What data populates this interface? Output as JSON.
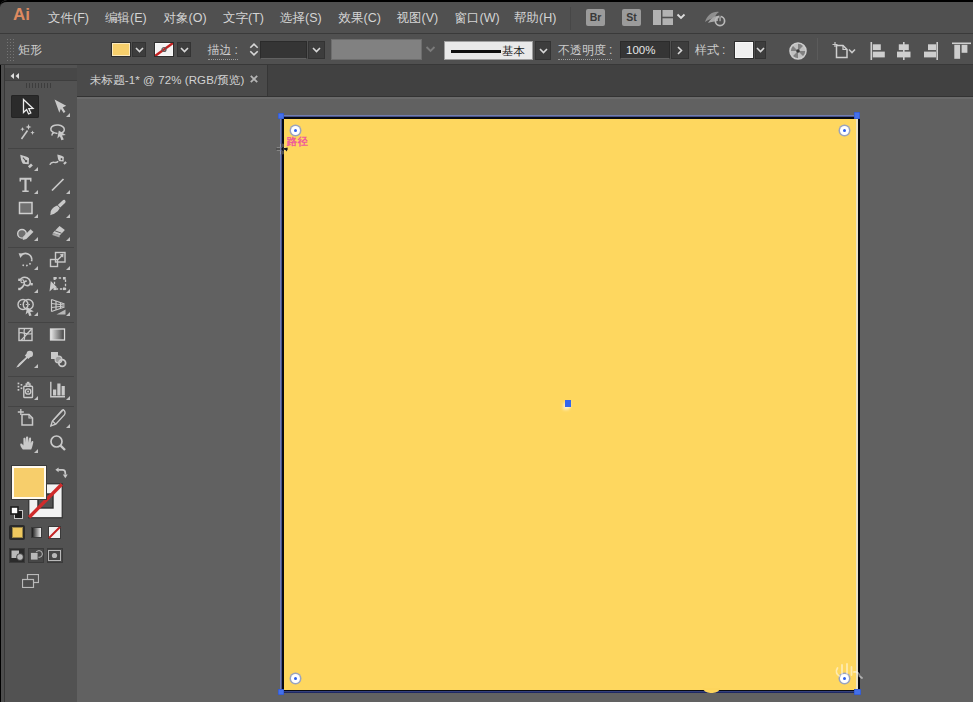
{
  "app": {
    "logo": "Ai",
    "accent_colors": {
      "fill_yellow": "#fcd464",
      "selection_blue": "#3d6bef",
      "smart_guide_pink": "#e95fa8"
    }
  },
  "menu_bar": {
    "items": [
      {
        "label": "文件(F)"
      },
      {
        "label": "编辑(E)"
      },
      {
        "label": "对象(O)"
      },
      {
        "label": "文字(T)"
      },
      {
        "label": "选择(S)"
      },
      {
        "label": "效果(C)"
      },
      {
        "label": "视图(V)"
      },
      {
        "label": "窗口(W)"
      },
      {
        "label": "帮助(H)"
      }
    ],
    "bridge_button": "Br",
    "stock_button": "St"
  },
  "control_bar": {
    "selection_type_label": "矩形",
    "stroke_label": "描边",
    "stroke_colon": ":",
    "stroke_width_value": "",
    "brush_name": "基本",
    "opacity_label": "不透明度",
    "opacity_colon": ":",
    "opacity_value": "100%",
    "style_label": "样式",
    "style_colon": ":"
  },
  "document_tab": {
    "title": "未标题-1* @ 72% (RGB/预览)"
  },
  "tools": [
    {
      "id": "selection-tool",
      "icon": "selection",
      "selected": true,
      "col": 0,
      "row": 0,
      "fly": false
    },
    {
      "id": "direct-selection-tool",
      "icon": "direct",
      "selected": false,
      "col": 1,
      "row": 0,
      "fly": true
    },
    {
      "id": "magic-wand-tool",
      "icon": "wand",
      "selected": false,
      "col": 0,
      "row": 1,
      "fly": false
    },
    {
      "id": "lasso-tool",
      "icon": "lasso",
      "selected": false,
      "col": 1,
      "row": 1,
      "fly": false
    },
    {
      "id": "pen-tool",
      "icon": "pen",
      "selected": false,
      "col": 0,
      "row": 2,
      "fly": true
    },
    {
      "id": "curvature-tool",
      "icon": "curvature",
      "selected": false,
      "col": 1,
      "row": 2,
      "fly": false
    },
    {
      "id": "type-tool",
      "icon": "type",
      "selected": false,
      "col": 0,
      "row": 3,
      "fly": true
    },
    {
      "id": "line-segment-tool",
      "icon": "line",
      "selected": false,
      "col": 1,
      "row": 3,
      "fly": true
    },
    {
      "id": "rectangle-tool",
      "icon": "rect",
      "selected": false,
      "col": 0,
      "row": 4,
      "fly": true
    },
    {
      "id": "paintbrush-tool",
      "icon": "brush",
      "selected": false,
      "col": 1,
      "row": 4,
      "fly": true
    },
    {
      "id": "shaper-tool",
      "icon": "shaper",
      "selected": false,
      "col": 0,
      "row": 5,
      "fly": true
    },
    {
      "id": "eraser-tool",
      "icon": "eraser",
      "selected": false,
      "col": 1,
      "row": 5,
      "fly": true
    },
    {
      "id": "rotate-tool",
      "icon": "rotate",
      "selected": false,
      "col": 0,
      "row": 6,
      "fly": true
    },
    {
      "id": "scale-tool",
      "icon": "scale",
      "selected": false,
      "col": 1,
      "row": 6,
      "fly": true
    },
    {
      "id": "width-tool",
      "icon": "width",
      "selected": false,
      "col": 0,
      "row": 7,
      "fly": true
    },
    {
      "id": "free-transform-tool",
      "icon": "freet",
      "selected": false,
      "col": 1,
      "row": 7,
      "fly": true
    },
    {
      "id": "shape-builder-tool",
      "icon": "shapebuilder",
      "selected": false,
      "col": 0,
      "row": 8,
      "fly": true
    },
    {
      "id": "perspective-grid-tool",
      "icon": "perspective",
      "selected": false,
      "col": 1,
      "row": 8,
      "fly": true
    },
    {
      "id": "mesh-tool",
      "icon": "mesh",
      "selected": false,
      "col": 0,
      "row": 9,
      "fly": false
    },
    {
      "id": "gradient-tool",
      "icon": "gradient",
      "selected": false,
      "col": 1,
      "row": 9,
      "fly": false
    },
    {
      "id": "eyedropper-tool",
      "icon": "eyedropper",
      "selected": false,
      "col": 0,
      "row": 10,
      "fly": true
    },
    {
      "id": "blend-tool",
      "icon": "blend",
      "selected": false,
      "col": 1,
      "row": 10,
      "fly": false
    },
    {
      "id": "symbol-sprayer-tool",
      "icon": "sprayer",
      "selected": false,
      "col": 0,
      "row": 11,
      "fly": true
    },
    {
      "id": "column-graph-tool",
      "icon": "graph",
      "selected": false,
      "col": 1,
      "row": 11,
      "fly": true
    },
    {
      "id": "artboard-tool",
      "icon": "artboard",
      "selected": false,
      "col": 0,
      "row": 12,
      "fly": false
    },
    {
      "id": "slice-tool",
      "icon": "slice",
      "selected": false,
      "col": 1,
      "row": 12,
      "fly": true
    },
    {
      "id": "hand-tool",
      "icon": "hand",
      "selected": false,
      "col": 0,
      "row": 13,
      "fly": true
    },
    {
      "id": "zoom-tool",
      "icon": "zoom",
      "selected": false,
      "col": 1,
      "row": 13,
      "fly": false
    }
  ],
  "canvas": {
    "smart_guide_label": "路径"
  }
}
